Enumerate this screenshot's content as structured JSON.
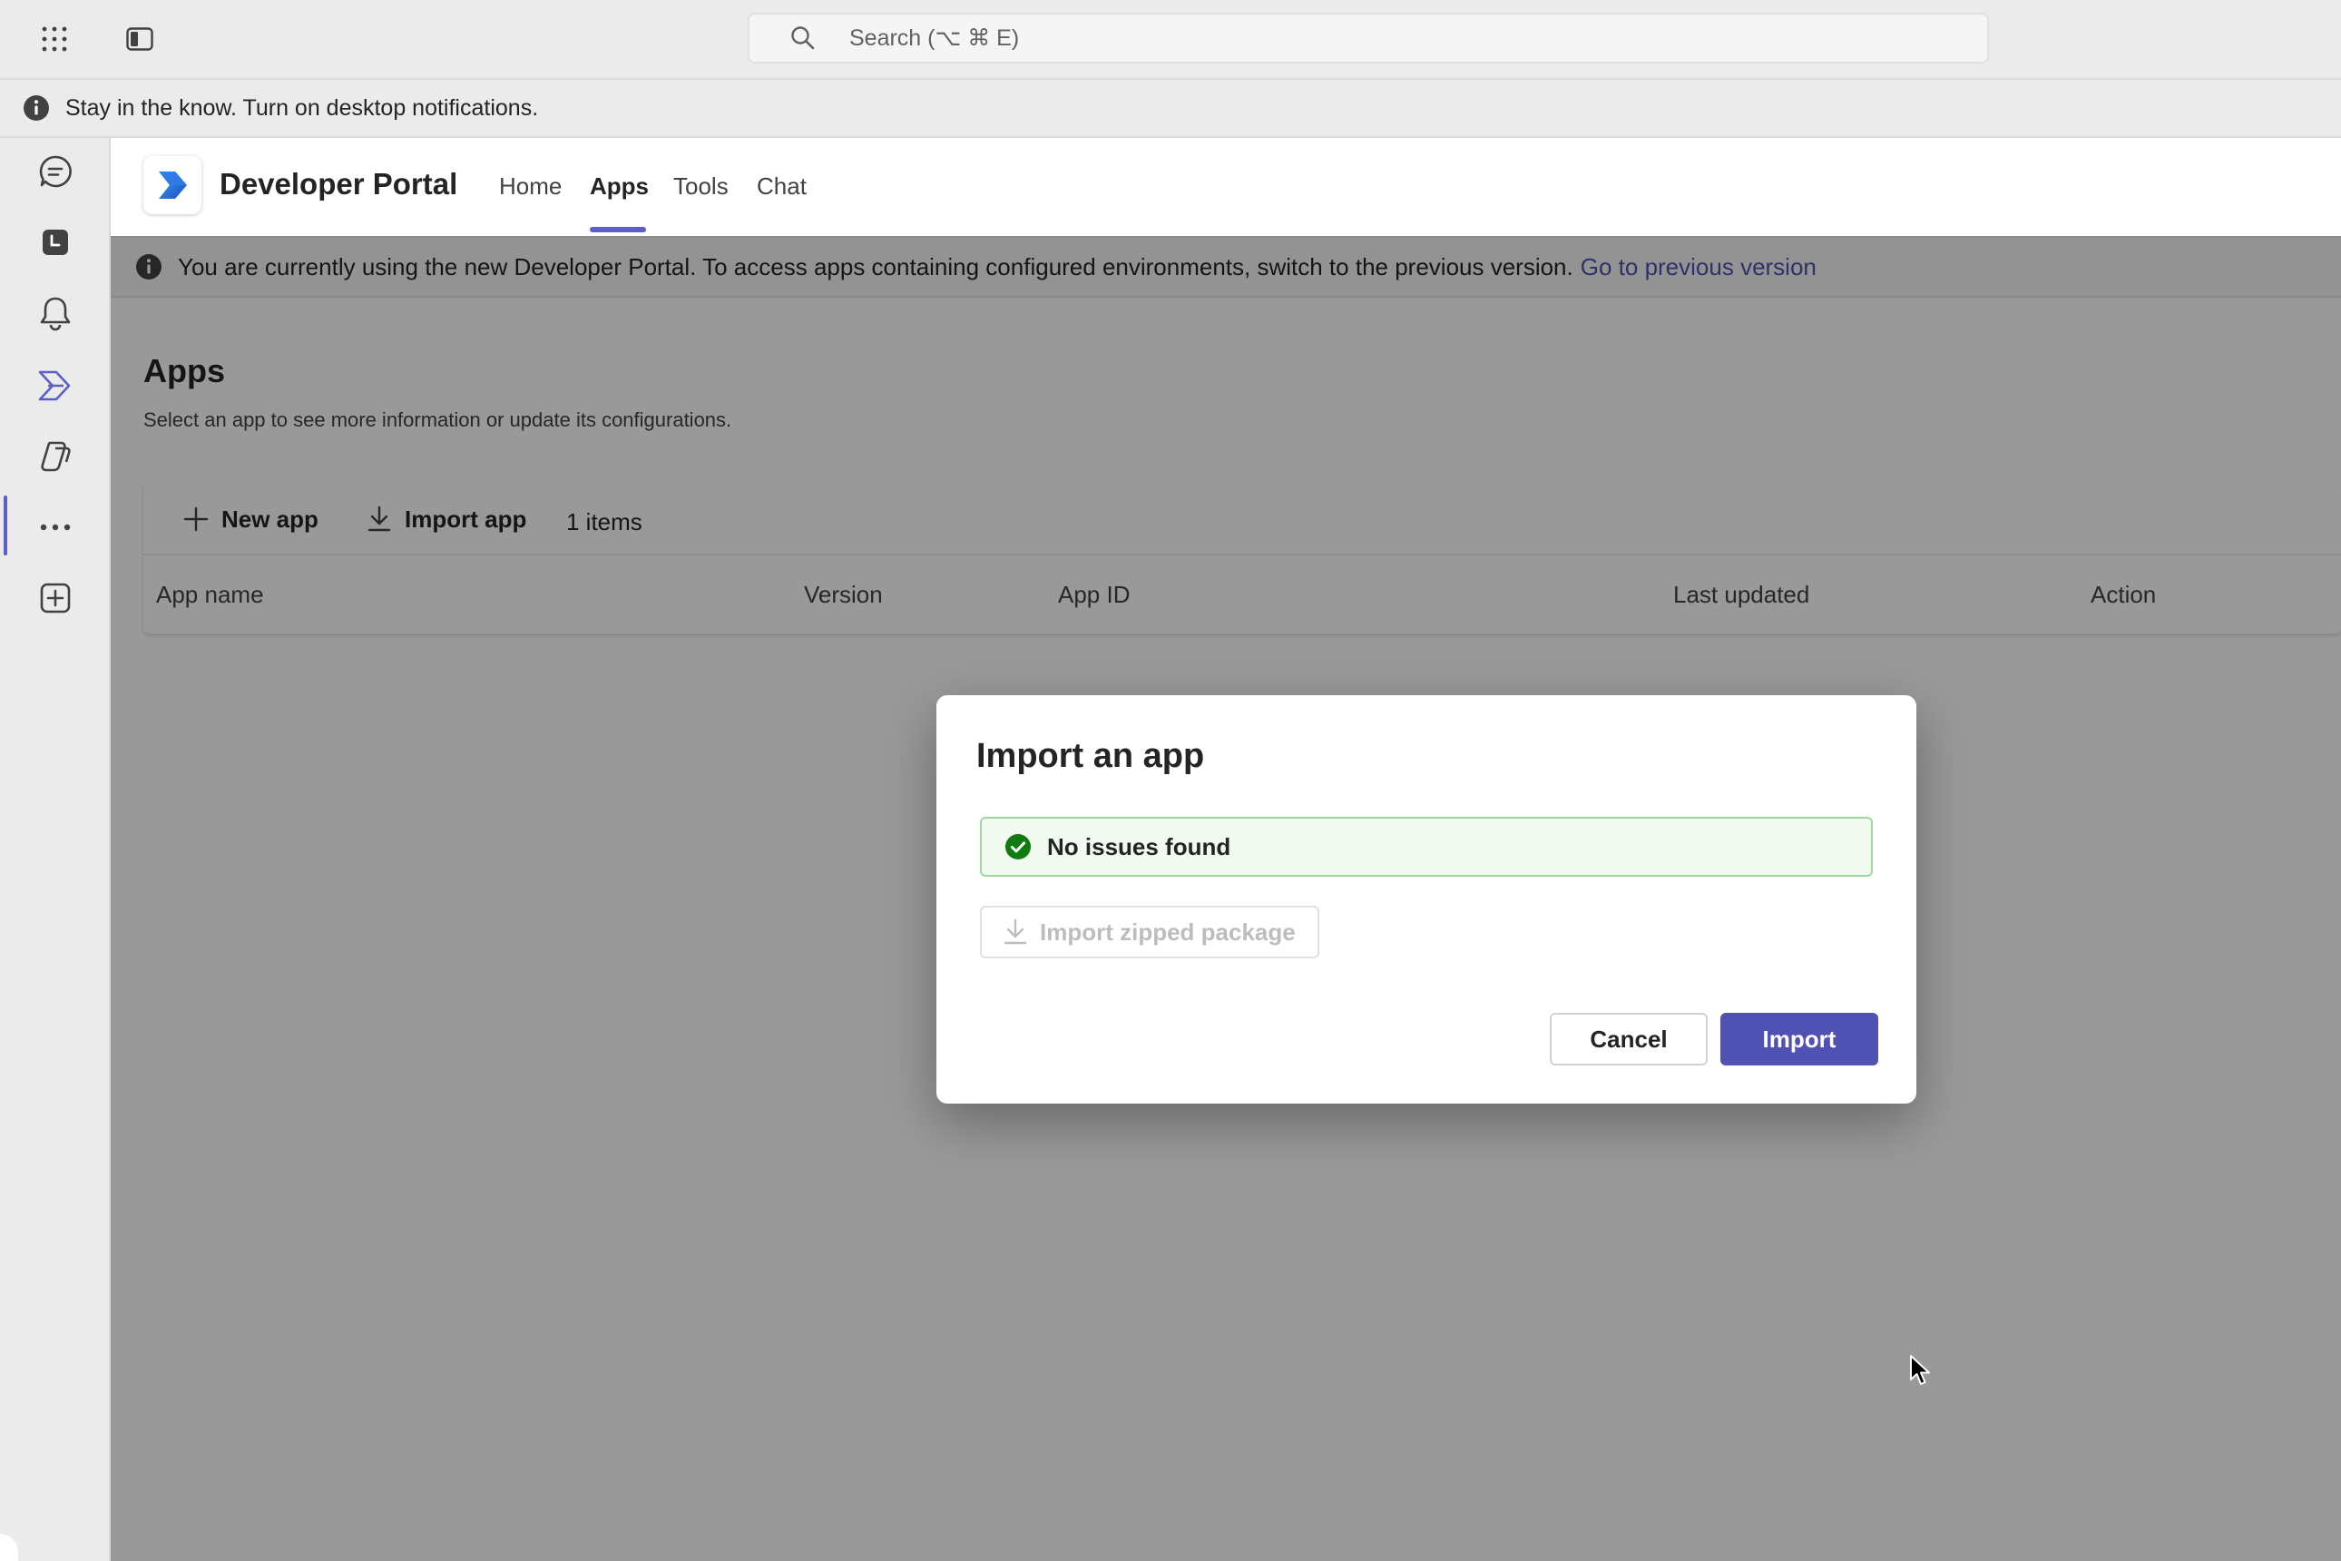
{
  "titlebar": {
    "search_placeholder": "Search (⌥ ⌘ E)",
    "icons": [
      "apps-grid-icon",
      "sidebar-toggle-icon",
      "search-icon"
    ]
  },
  "notification": {
    "text": "Stay in the know. Turn on desktop notifications."
  },
  "rail": {
    "items": [
      "chat-icon",
      "calendar-icon",
      "activity-bell-icon",
      "developer-portal-icon",
      "copilot-icon",
      "more-icon",
      "add-app-icon"
    ],
    "active": "developer-portal-icon"
  },
  "app": {
    "title": "Developer Portal",
    "tabs": [
      {
        "label": "Home"
      },
      {
        "label": "Apps"
      },
      {
        "label": "Tools"
      },
      {
        "label": "Chat"
      }
    ],
    "active_tab": "Apps",
    "banner_text": "You are currently using the new Developer Portal. To access apps containing configured environments, switch to the previous version.",
    "banner_link": "Go to previous version"
  },
  "page": {
    "title": "Apps",
    "subtitle": "Select an app to see more information or update its configurations.",
    "toolbar": {
      "new_app": "New app",
      "import_app": "Import app",
      "count": "1 items"
    },
    "columns": [
      "App name",
      "Version",
      "App ID",
      "Last updated",
      "Action"
    ]
  },
  "dialog": {
    "title": "Import an app",
    "status_text": "No issues found",
    "zip_button": "Import zipped package",
    "cancel_label": "Cancel",
    "import_label": "Import"
  },
  "colors": {
    "accent": "#5b5fc7",
    "primary_button": "#4f52b2",
    "link": "#4f52b2",
    "success_bg": "#f1faf1",
    "success_icon": "#107c10"
  }
}
